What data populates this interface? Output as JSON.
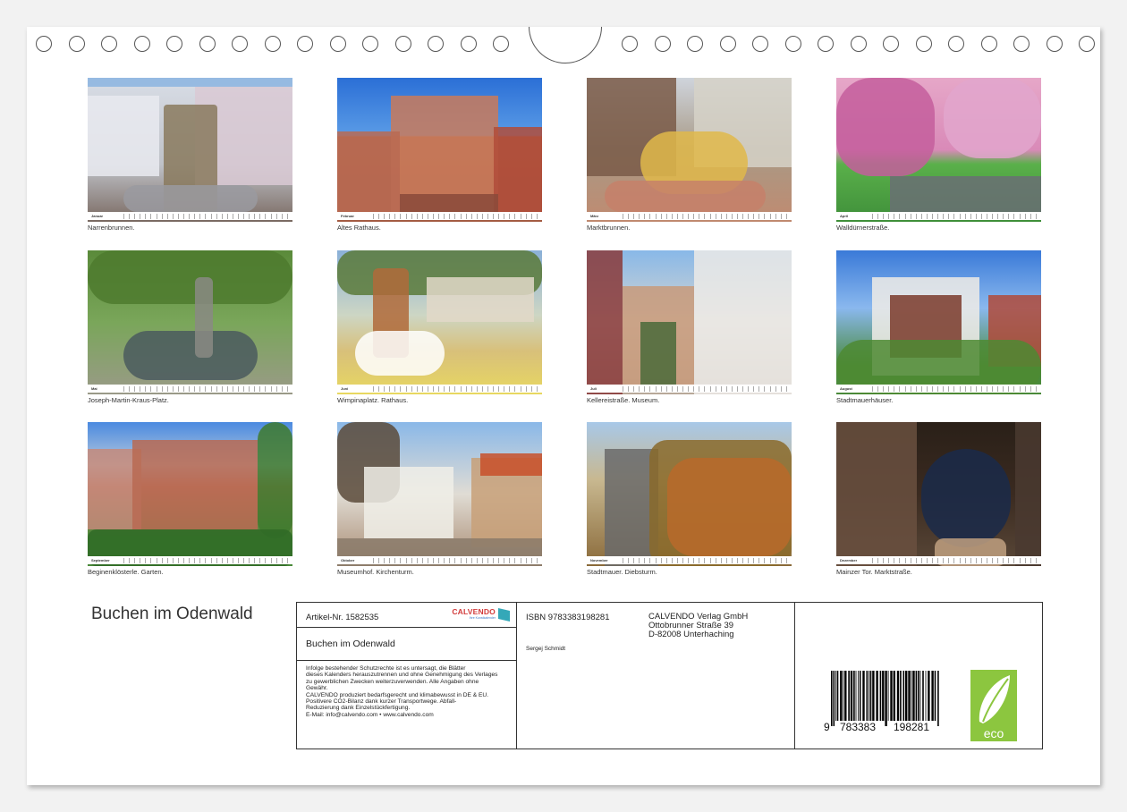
{
  "calendar": {
    "months": [
      {
        "name": "Januar",
        "caption": "Narrenbrunnen."
      },
      {
        "name": "Februar",
        "caption": "Altes Rathaus."
      },
      {
        "name": "März",
        "caption": "Marktbrunnen."
      },
      {
        "name": "April",
        "caption": "Walldürnerstraße."
      },
      {
        "name": "Mai",
        "caption": "Joseph-Martin-Kraus-Platz."
      },
      {
        "name": "Juni",
        "caption": "Wimpinaplatz. Rathaus."
      },
      {
        "name": "Juli",
        "caption": "Kellereistraße. Museum."
      },
      {
        "name": "August",
        "caption": "Stadtmauerhäuser."
      },
      {
        "name": "September",
        "caption": "Beginenklösterle. Garten."
      },
      {
        "name": "Oktober",
        "caption": "Museumhof. Kirchenturm."
      },
      {
        "name": "November",
        "caption": "Stadtmauer. Diebsturm."
      },
      {
        "name": "Dezember",
        "caption": "Mainzer Tor. Marktstraße."
      }
    ]
  },
  "back_cover": {
    "title": "Buchen im Odenwald",
    "article": "Artikel-Nr. 1582535",
    "product_title": "Buchen im Odenwald",
    "logo_word": "CALVENDO",
    "logo_sub": "Ihre Kunstkalender",
    "legal_lines": [
      "Infolge bestehender Schutzrechte ist es untersagt, die Blätter",
      "dieses Kalenders herauszutrennen und ohne Genehmigung des Verlages",
      "zu gewerblichen Zwecken weiterzuverwenden. Alle Angaben ohne",
      "Gewähr.",
      "CALVENDO produziert bedarfsgerecht und klimabewusst in DE & EU.",
      "Positivere CO2-Bilanz dank kurzer Transportwege. Abfall-",
      "Reduzierung dank Einzelstückfertigung.",
      "E-Mail: info@calvendo.com • www.calvendo.com"
    ],
    "isbn": "ISBN 9783383198281",
    "author": "Sergej Schmidt",
    "publisher_lines": [
      "CALVENDO Verlag GmbH",
      "Ottobrunner Straße 39",
      "D-82008 Unterhaching"
    ],
    "barcode_digits": [
      "9",
      "783383",
      "198281"
    ],
    "eco_label": "eco"
  }
}
